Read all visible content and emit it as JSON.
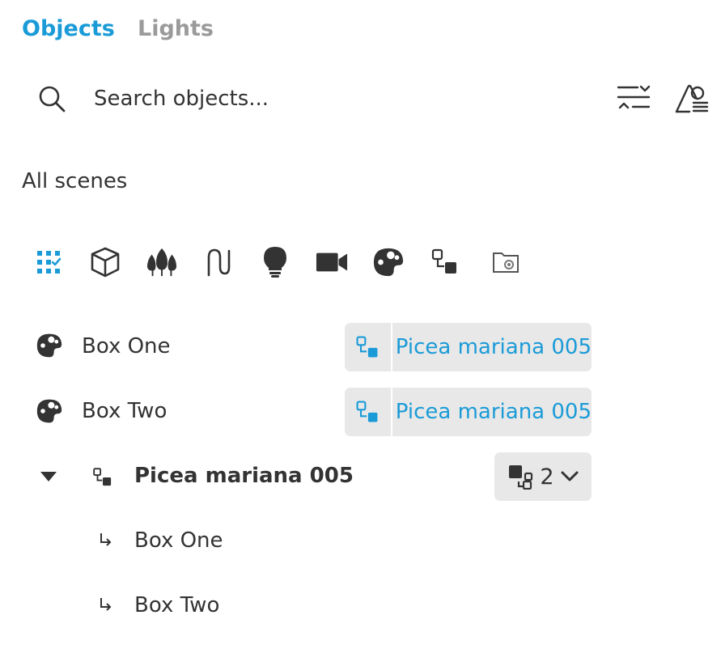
{
  "tabs": [
    {
      "label": "Objects",
      "active": true,
      "color": "#1a9bd7"
    },
    {
      "label": "Lights",
      "active": false,
      "color": "#9a9a9a"
    }
  ],
  "search": {
    "placeholder": "Search objects...",
    "value": ""
  },
  "toolbar": {
    "icons": [
      "sort-icon",
      "shape-list-icon"
    ]
  },
  "scope_label": "All scenes",
  "filters": [
    {
      "icon": "all-grid-icon",
      "active": true
    },
    {
      "icon": "cube-icon",
      "active": false
    },
    {
      "icon": "trees-icon",
      "active": false
    },
    {
      "icon": "curve-icon",
      "active": false
    },
    {
      "icon": "lightbulb-icon",
      "active": false
    },
    {
      "icon": "camera-icon",
      "active": false
    },
    {
      "icon": "material-palette-icon",
      "active": false
    },
    {
      "icon": "group-link-icon",
      "active": false
    },
    {
      "icon": "folder-settings-icon",
      "active": false
    }
  ],
  "rows": [
    {
      "icon": "material-palette-icon",
      "label": "Box One",
      "link": "Picea mariana 005"
    },
    {
      "icon": "material-palette-icon",
      "label": "Box Two",
      "link": "Picea mariana 005"
    }
  ],
  "group": {
    "label": "Picea mariana 005",
    "count": "2",
    "expanded": true,
    "children": [
      {
        "label": "Box One"
      },
      {
        "label": "Box Two"
      }
    ]
  },
  "colors": {
    "accent": "#1a9bd7",
    "text": "#333333",
    "muted": "#9a9a9a",
    "pill": "#e8e8e8"
  }
}
